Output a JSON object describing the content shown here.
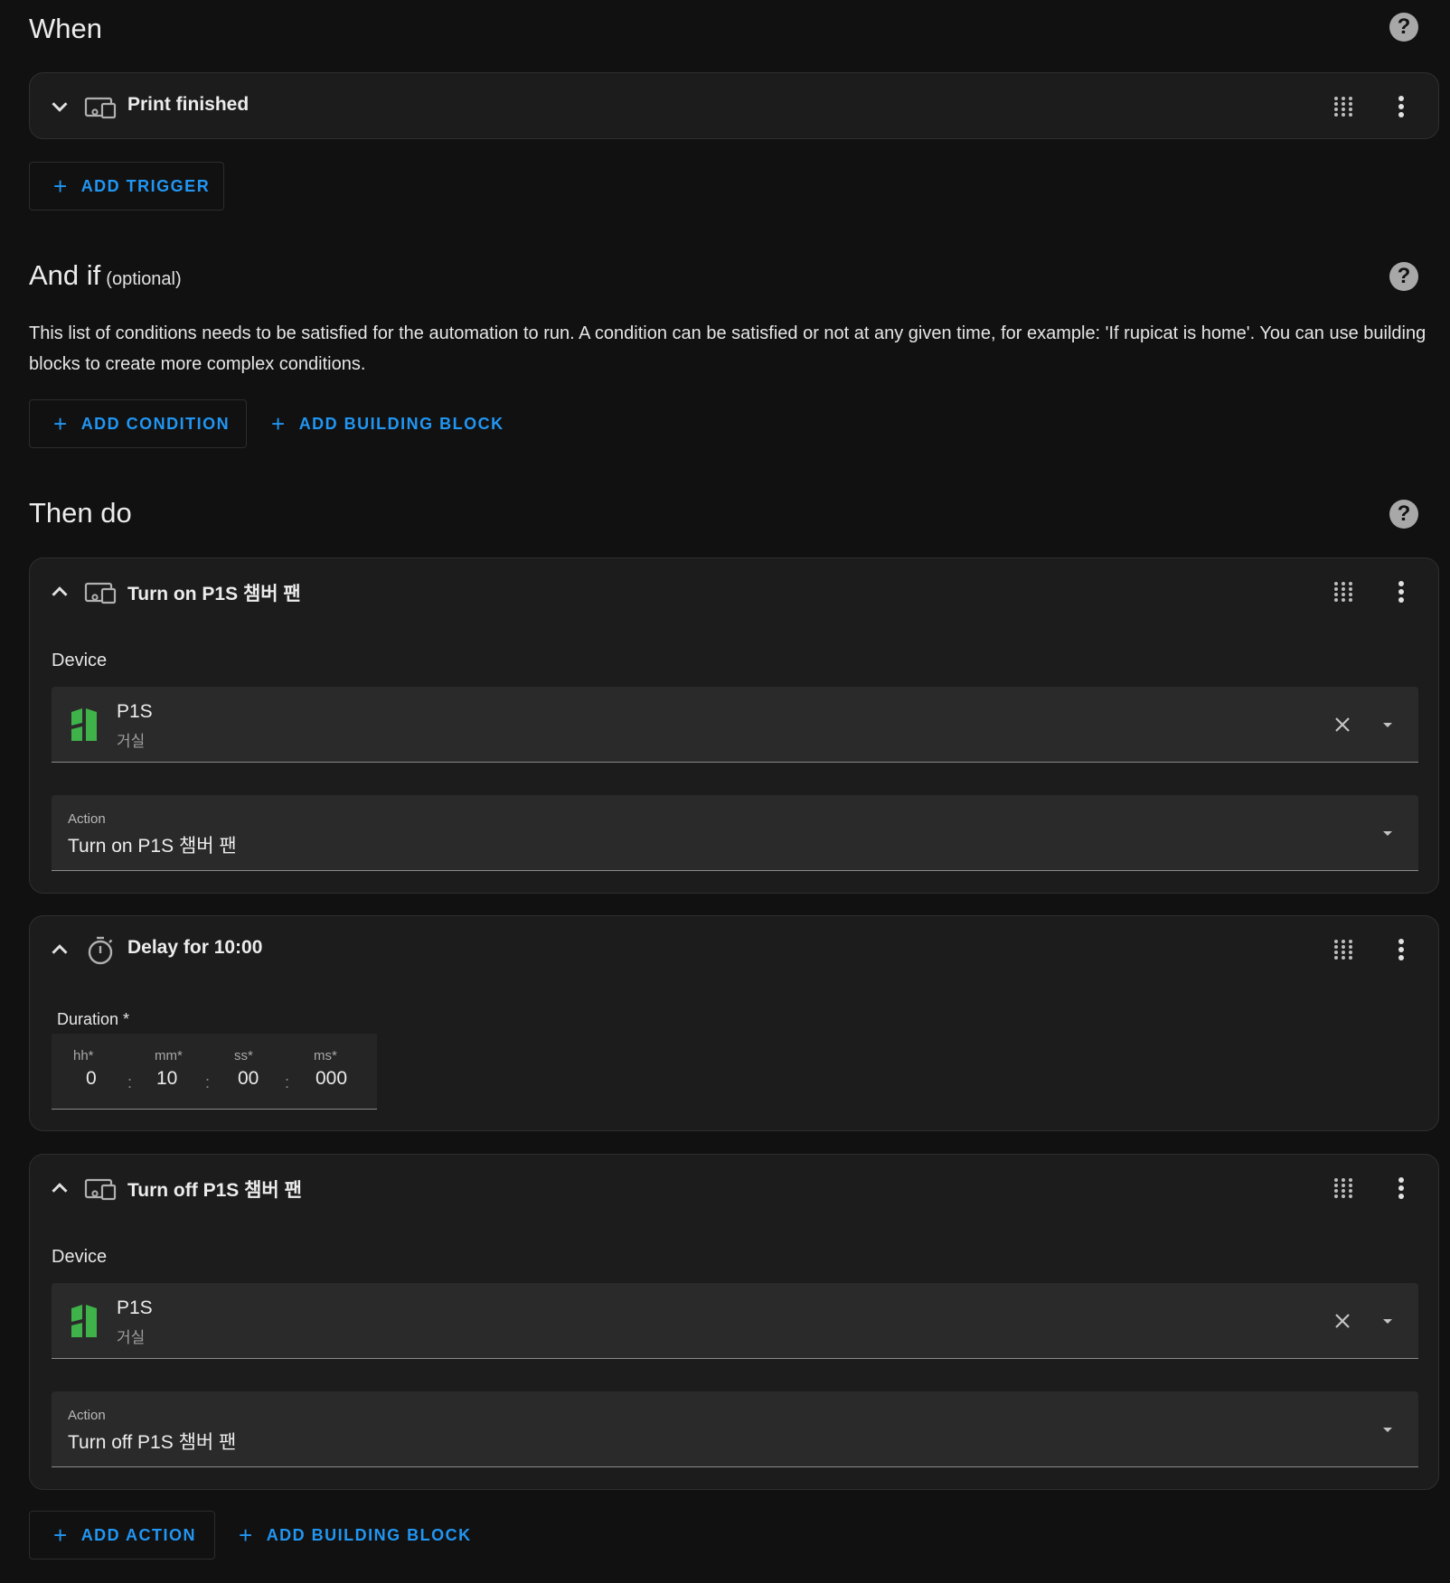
{
  "when": {
    "title": "When",
    "trigger": {
      "title": "Print finished"
    },
    "add_trigger": "ADD TRIGGER"
  },
  "and_if": {
    "title": "And if",
    "optional": "(optional)",
    "description": "This list of conditions needs to be satisfied for the automation to run. A condition can be satisfied or not at any given time, for example: 'If rupicat is home'. You can use building blocks to create more complex conditions.",
    "add_condition": "ADD CONDITION",
    "add_building_block": "ADD BUILDING BLOCK"
  },
  "then_do": {
    "title": "Then do",
    "actions": [
      {
        "title": "Turn on P1S 챔버 팬",
        "device_label": "Device",
        "device_name": "P1S",
        "device_area": "거실",
        "action_label": "Action",
        "action_value": "Turn on P1S 챔버 팬"
      },
      {
        "title": "Delay for 10:00",
        "duration_label": "Duration *",
        "fields": [
          {
            "label": "hh*",
            "value": "0"
          },
          {
            "label": "mm*",
            "value": "10"
          },
          {
            "label": "ss*",
            "value": "00"
          },
          {
            "label": "ms*",
            "value": "000"
          }
        ],
        "separator": ":"
      },
      {
        "title": "Turn off P1S 챔버 팬",
        "device_label": "Device",
        "device_name": "P1S",
        "device_area": "거실",
        "action_label": "Action",
        "action_value": "Turn off P1S 챔버 팬"
      }
    ],
    "add_action": "ADD ACTION",
    "add_building_block": "ADD BUILDING BLOCK"
  },
  "icons": {
    "help": "help-circle-icon",
    "chevron_down": "chevron-down-icon",
    "chevron_up": "chevron-up-icon",
    "device": "devices-icon",
    "timer": "timer-icon",
    "drag": "drag-handle-icon",
    "more": "more-vertical-icon",
    "clear": "close-icon",
    "dropdown": "menu-down-icon",
    "plus": "plus-icon"
  },
  "colors": {
    "accent": "#2196f3",
    "background": "#111111",
    "card": "#1c1c1c",
    "field": "#2a2a2a",
    "device_logo": "#3fb24a"
  }
}
